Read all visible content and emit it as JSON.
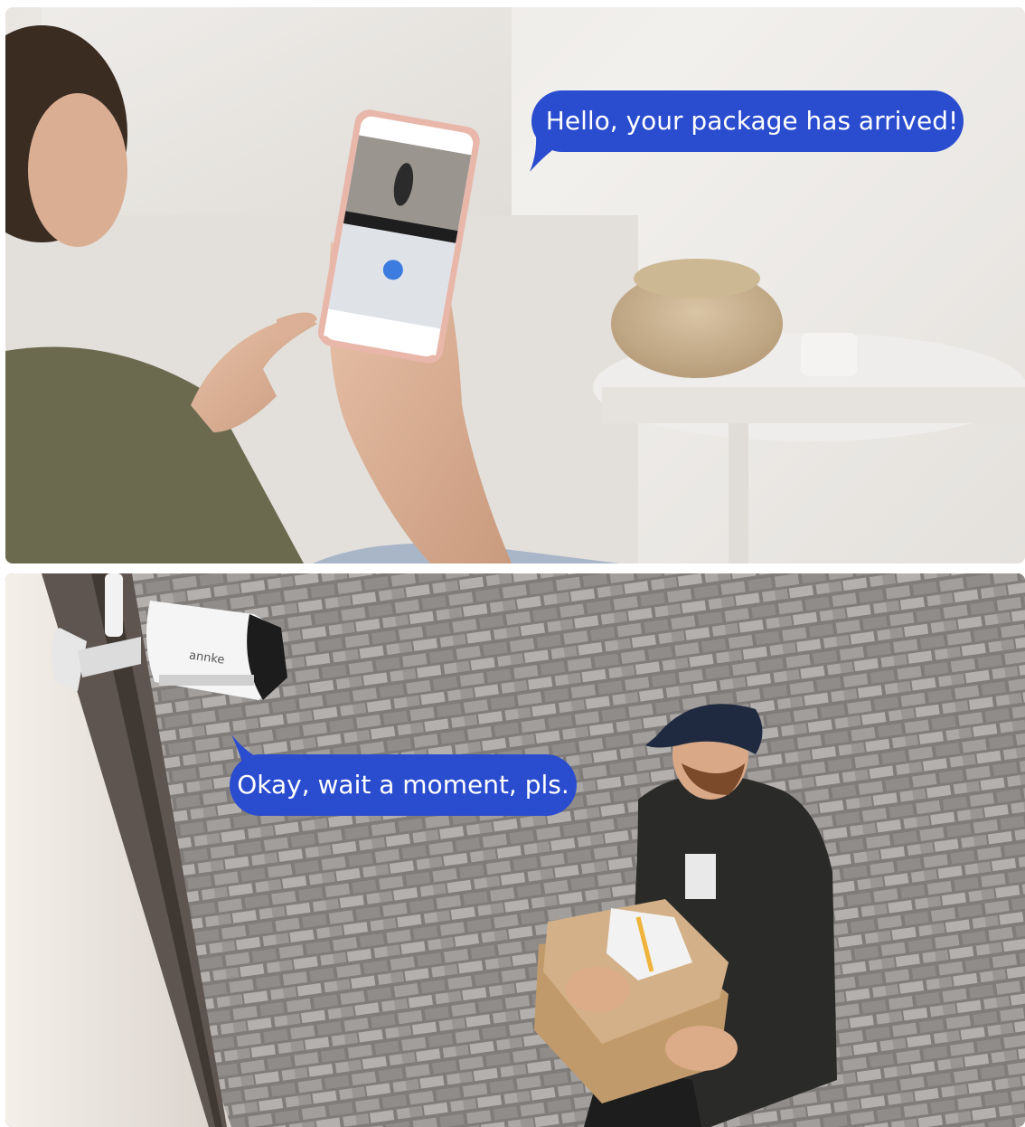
{
  "scene_top": {
    "speech_bubble": "Hello, your package has arrived!"
  },
  "scene_bottom": {
    "speech_bubble": "Okay, wait a moment, pls.",
    "camera_brand": "annke"
  },
  "colors": {
    "bubble": "#2a4ccf",
    "bubble_text": "#ffffff"
  }
}
